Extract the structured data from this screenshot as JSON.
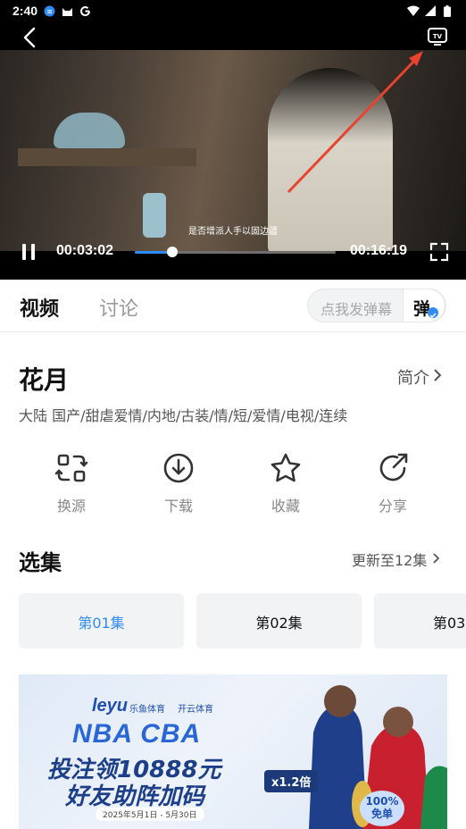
{
  "status_bar": {
    "time": "2:40",
    "left_icons": [
      "notification-badge-icon",
      "cat-icon",
      "google-icon"
    ],
    "right_icons": [
      "wifi-icon",
      "signal-icon",
      "battery-icon"
    ]
  },
  "player": {
    "subtitle": "是否增派人手以固边疆",
    "current_time": "00:03:02",
    "total_time": "00:16:19",
    "progress_fraction": 0.185,
    "accent_color": "#2f8bf5"
  },
  "tabs": {
    "video_label": "视频",
    "discussion_label": "讨论"
  },
  "danmu": {
    "placeholder": "点我发弹幕",
    "button_label": "弹"
  },
  "show": {
    "title": "花月",
    "intro_label": "简介",
    "tags": "大陆  国产/甜虐爱情/内地/古装/情/短/爱情/电视/连续"
  },
  "actions": [
    {
      "label": "换源",
      "icon": "switch-source-icon"
    },
    {
      "label": "下载",
      "icon": "download-icon"
    },
    {
      "label": "收藏",
      "icon": "star-icon"
    },
    {
      "label": "分享",
      "icon": "share-icon"
    }
  ],
  "episodes": {
    "heading": "选集",
    "update_text": "更新至12集",
    "items": [
      {
        "label": "第01集",
        "active": true
      },
      {
        "label": "第02集",
        "active": false
      },
      {
        "label": "第03集",
        "active": false
      }
    ]
  },
  "banner": {
    "logo": "leyu",
    "logo_sub": "乐鱼体育",
    "sponsor": "开云体育",
    "headline1": "NBA CBA",
    "headline2": "投注领10888元",
    "headline3": "好友助阵加码",
    "date": "2025年5月1日 - 5月30日",
    "multiplier": "x1.2倍",
    "badge": "100%",
    "badge_sub": "免单"
  }
}
